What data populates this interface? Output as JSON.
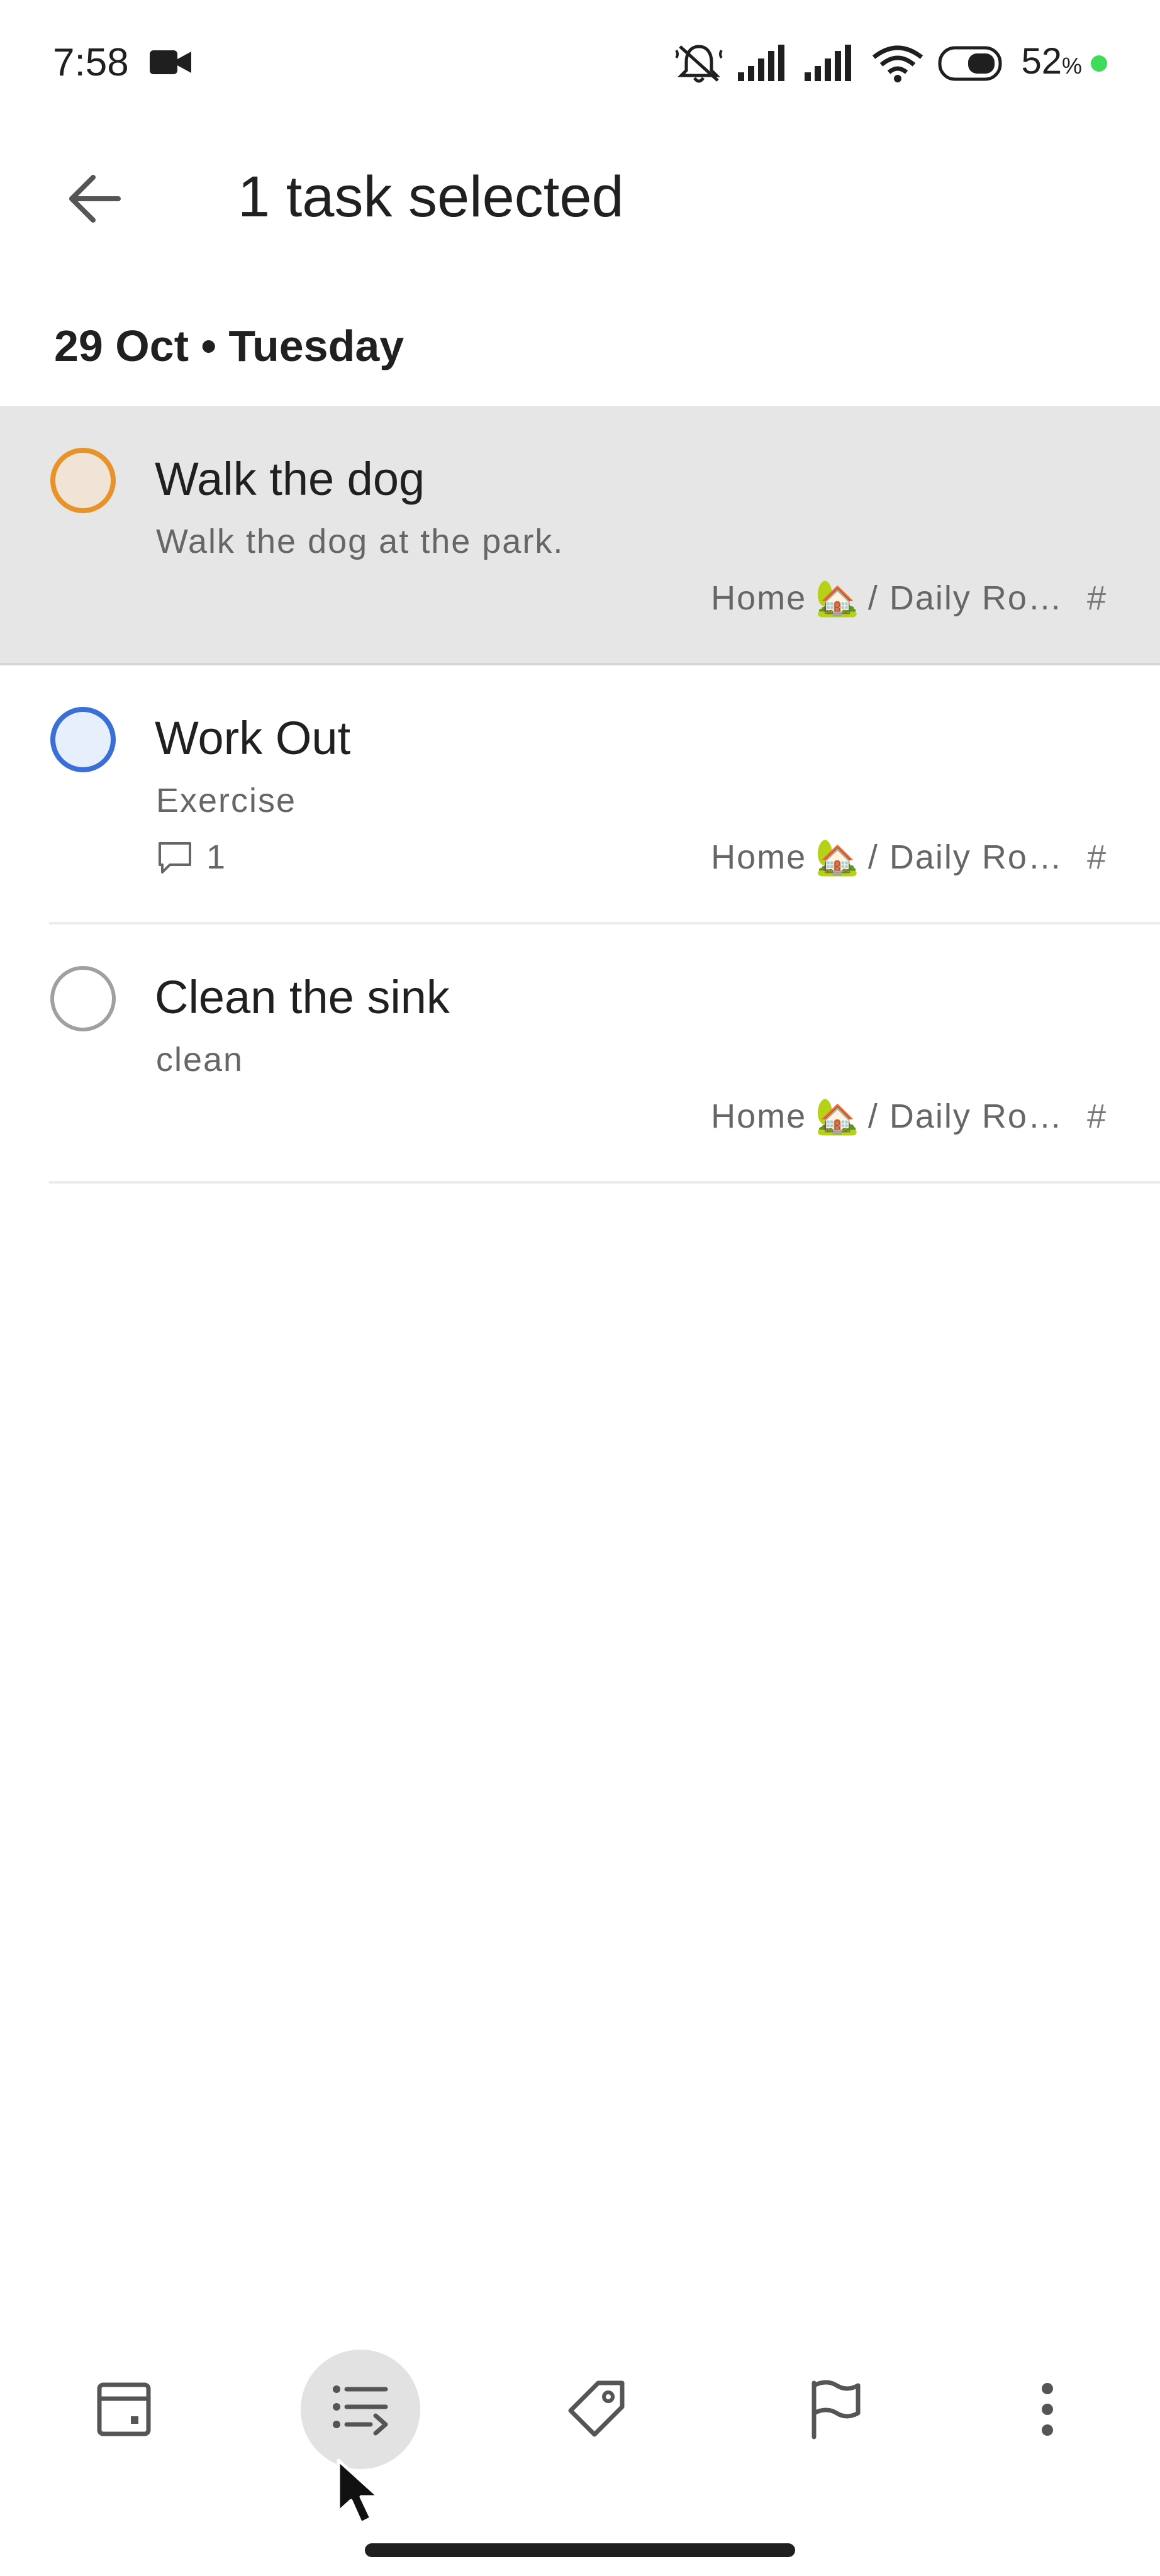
{
  "status_bar": {
    "time": "7:58",
    "battery_percent": "52",
    "battery_percent_unit": "%",
    "icons": [
      "video-record-icon",
      "bell-muted-icon",
      "signal-icon",
      "signal-icon",
      "wifi-icon",
      "battery-icon"
    ]
  },
  "app_bar": {
    "title": "1 task selected",
    "back_icon": "arrow-left-icon"
  },
  "section": {
    "date_header": "29 Oct • Tuesday"
  },
  "tasks": [
    {
      "title": "Walk the dog",
      "description": "Walk the dog at the park.",
      "project": "Home",
      "project_emoji": "🏡",
      "section": "/ Daily Ro…",
      "project_hash": "#",
      "selected": true,
      "priority_color": "#e6942a"
    },
    {
      "title": "Work Out",
      "description": "Exercise",
      "comment_count": "1",
      "project": "Home",
      "project_emoji": "🏡",
      "section": "/ Daily Ro…",
      "project_hash": "#",
      "selected": false,
      "priority_color": "#3a6fd8"
    },
    {
      "title": "Clean the sink",
      "description": "clean",
      "project": "Home",
      "project_emoji": "🏡",
      "section": "/ Daily Ro…",
      "project_hash": "#",
      "selected": false,
      "priority_color": "#a0a0a0"
    }
  ],
  "toolbar": {
    "items": [
      "schedule-icon",
      "move-to-project-icon",
      "label-icon",
      "priority-flag-icon",
      "more-options-icon"
    ],
    "active_item": "move-to-project-icon"
  },
  "colors": {
    "selected_row": "#e6e6e6",
    "priority_2": "#e6942a",
    "priority_3": "#3a6fd8",
    "text_primary": "#202020",
    "text_secondary": "#666666"
  }
}
